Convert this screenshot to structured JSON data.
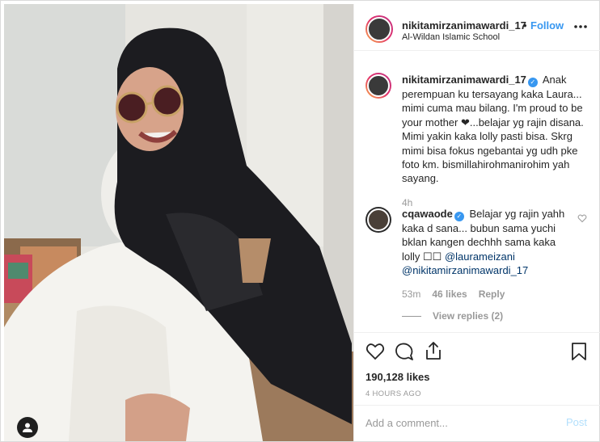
{
  "post": {
    "username": "nikitamirzanimawardi_17",
    "separator": "•",
    "follow_label": "Follow",
    "location": "Al-Wildan Islamic School"
  },
  "caption": {
    "username": "nikitamirzanimawardi_17",
    "verified_glyph": "✓",
    "text": "Anak perempuan ku tersayang kaka Laura... mimi cuma mau bilang. I'm proud to be your mother ❤...belajar yg rajin disana. Mimi yakin kaka lolly pasti bisa. Skrg mimi bisa fokus ngebantai yg udh pke foto km. bismillahirohmanirohim yah sayang.",
    "time": "4h"
  },
  "comment": {
    "username": "cqawaode",
    "verified_glyph": "✓",
    "text": "Belajar yg rajin yahh kaka d sana... bubun sama yuchi bklan kangen dechhh sama kaka lolly ☐☐",
    "mention_1": "@laurameizani",
    "mention_2": "@nikitamirzanimawardi_17",
    "time": "53m",
    "likes": "46 likes",
    "reply_label": "Reply",
    "view_replies": "View replies (2)"
  },
  "actions": {
    "likes_count": "190,128 likes",
    "posted_ago": "4 HOURS AGO"
  },
  "add_comment": {
    "placeholder": "Add a comment...",
    "post_label": "Post"
  },
  "icons": {
    "more": "more-options-icon",
    "like": "heart-icon",
    "comment": "comment-icon",
    "share": "share-icon",
    "save": "bookmark-icon",
    "tag": "user-tag-icon"
  },
  "colors": {
    "link_blue": "#3897f0",
    "post_disabled": "#b2dffc",
    "secondary_text": "#999999",
    "border": "#efefef"
  }
}
